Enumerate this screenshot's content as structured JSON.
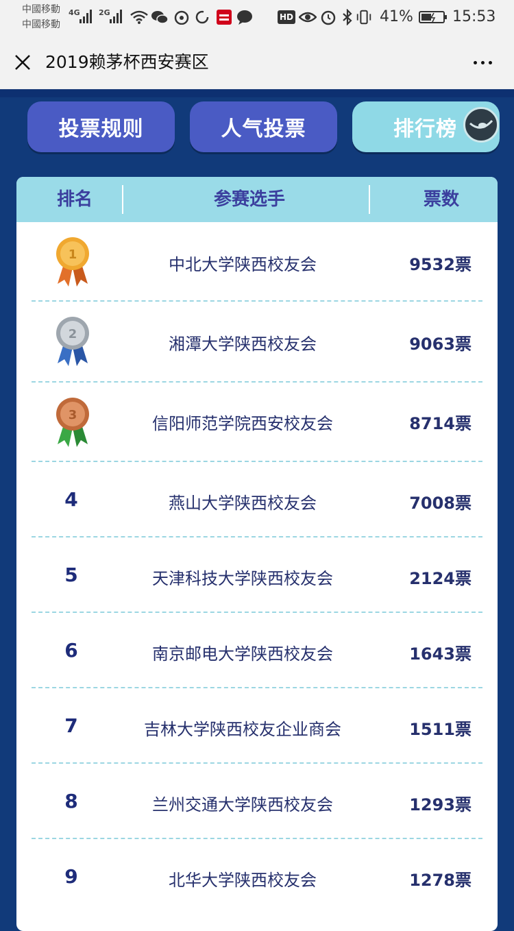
{
  "status_bar": {
    "carrier1": "中國移動",
    "carrier2": "中國移動",
    "net1": "4G",
    "net2": "2G",
    "hd": "HD",
    "battery": "41%",
    "time": "15:53"
  },
  "nav": {
    "title": "2019赖茅杯西安赛区"
  },
  "tabs": [
    {
      "label": "投票规则"
    },
    {
      "label": "人气投票"
    },
    {
      "label": "排行榜"
    }
  ],
  "table": {
    "headers": {
      "rank": "排名",
      "player": "参赛选手",
      "votes": "票数"
    },
    "rows": [
      {
        "rank": "1",
        "name": "中北大学陕西校友会",
        "votes": "9532票",
        "medal": "gold"
      },
      {
        "rank": "2",
        "name": "湘潭大学陕西校友会",
        "votes": "9063票",
        "medal": "silver"
      },
      {
        "rank": "3",
        "name": "信阳师范学院西安校友会",
        "votes": "8714票",
        "medal": "bronze"
      },
      {
        "rank": "4",
        "name": "燕山大学陕西校友会",
        "votes": "7008票"
      },
      {
        "rank": "5",
        "name": "天津科技大学陕西校友会",
        "votes": "2124票"
      },
      {
        "rank": "6",
        "name": "南京邮电大学陕西校友会",
        "votes": "1643票"
      },
      {
        "rank": "7",
        "name": "吉林大学陕西校友企业商会",
        "votes": "1511票"
      },
      {
        "rank": "8",
        "name": "兰州交通大学陕西校友会",
        "votes": "1293票"
      },
      {
        "rank": "9",
        "name": "北华大学陕西校友会",
        "votes": "1278票"
      }
    ]
  },
  "colors": {
    "background": "#113a7a",
    "tab": "#4a5bc4",
    "tab_active": "#8fd9e6",
    "header": "#9adbe8",
    "text": "#26306d"
  }
}
